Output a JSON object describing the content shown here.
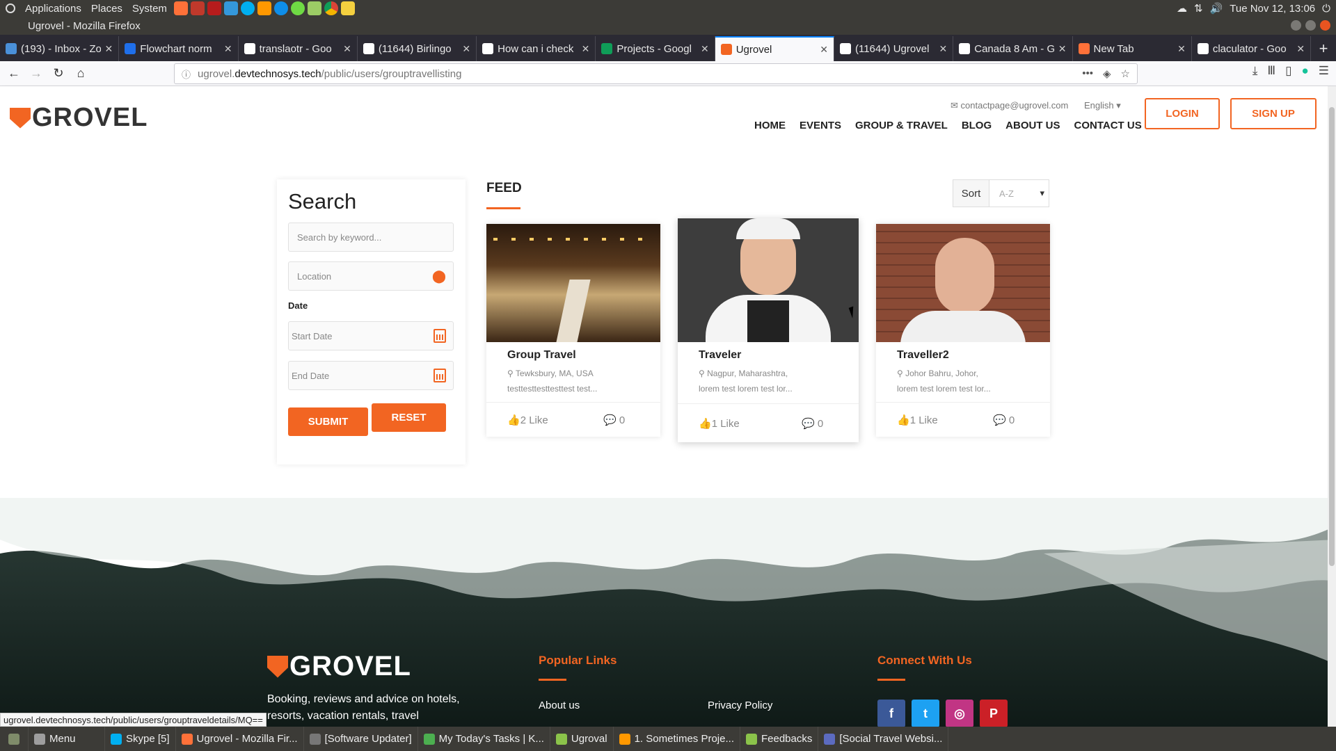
{
  "system": {
    "menu": [
      "Applications",
      "Places",
      "System"
    ],
    "clock": "Tue Nov 12, 13:06"
  },
  "window": {
    "title": "Ugrovel - Mozilla Firefox"
  },
  "tabs": [
    {
      "label": "(193) - Inbox - Zo",
      "color": "#4a90d9"
    },
    {
      "label": "Flowchart norm",
      "color": "#1f6feb"
    },
    {
      "label": "translaotr - Goo",
      "color": "#ffffff"
    },
    {
      "label": "(11644) Birlingo",
      "color": "#ffffff"
    },
    {
      "label": "How can i check",
      "color": "#ffffff"
    },
    {
      "label": "Projects - Googl",
      "color": "#0f9d58"
    },
    {
      "label": "Ugrovel",
      "color": "#f26522",
      "active": true
    },
    {
      "label": "(11644) Ugrovel",
      "color": "#ffffff"
    },
    {
      "label": "Canada 8 Am - G",
      "color": "#ffffff"
    },
    {
      "label": "New Tab",
      "color": "#ff7139"
    },
    {
      "label": "claculator - Goo",
      "color": "#ffffff"
    }
  ],
  "urlbar": {
    "prefix": "ugrovel.",
    "host": "devtechnosys.tech",
    "path": "/public/users/grouptravellisting"
  },
  "site": {
    "logo": "GROVEL",
    "contact_email": "contactpage@ugrovel.com",
    "language": "English",
    "nav": [
      "HOME",
      "EVENTS",
      "GROUP & TRAVEL",
      "BLOG",
      "ABOUT US",
      "CONTACT US"
    ],
    "login": "LOGIN",
    "signup": "SIGN UP"
  },
  "search": {
    "title": "Search",
    "keyword_placeholder": "Search by keyword...",
    "location_placeholder": "Location",
    "date_label": "Date",
    "start_date_placeholder": "Start Date",
    "end_date_placeholder": "End Date",
    "submit": "SUBMIT",
    "reset": "RESET"
  },
  "feed": {
    "title": "FEED",
    "sort_label": "Sort",
    "sort_value": "A-Z",
    "cards": [
      {
        "title": "Group Travel",
        "location": "Tewksbury, MA, USA",
        "desc": "testtesttesttesttest test...",
        "likes": "2 Like",
        "comments": "0"
      },
      {
        "title": "Traveler",
        "location": "Nagpur, Maharashtra,",
        "desc": "lorem test lorem test lor...",
        "likes": "1 Like",
        "comments": "0"
      },
      {
        "title": "Traveller2",
        "location": "Johor Bahru, Johor,",
        "desc": "lorem test lorem test lor...",
        "likes": "1 Like",
        "comments": "0"
      }
    ]
  },
  "footer": {
    "logo": "GROVEL",
    "desc_line1": "Booking, reviews and advice on hotels,",
    "desc_line2": "resorts, vacation rentals, travel",
    "popular_links": "Popular Links",
    "about_us": "About us",
    "privacy_policy": "Privacy Policy",
    "connect": "Connect With Us",
    "social": {
      "facebook": "#3b5998",
      "twitter": "#1da1f2",
      "instagram": "#c13584",
      "pinterest": "#cb2027"
    }
  },
  "status_url": "ugrovel.devtechnosys.tech/public/users/grouptraveldetails/MQ==",
  "taskbar": [
    {
      "label": "Menu"
    },
    {
      "label": "Skype [5]"
    },
    {
      "label": "Ugrovel - Mozilla Fir..."
    },
    {
      "label": "[Software Updater]"
    },
    {
      "label": "My Today's Tasks | K..."
    },
    {
      "label": "Ugroval"
    },
    {
      "label": "1. Sometimes Proje..."
    },
    {
      "label": "Feedbacks"
    },
    {
      "label": "[Social Travel Websi..."
    }
  ]
}
